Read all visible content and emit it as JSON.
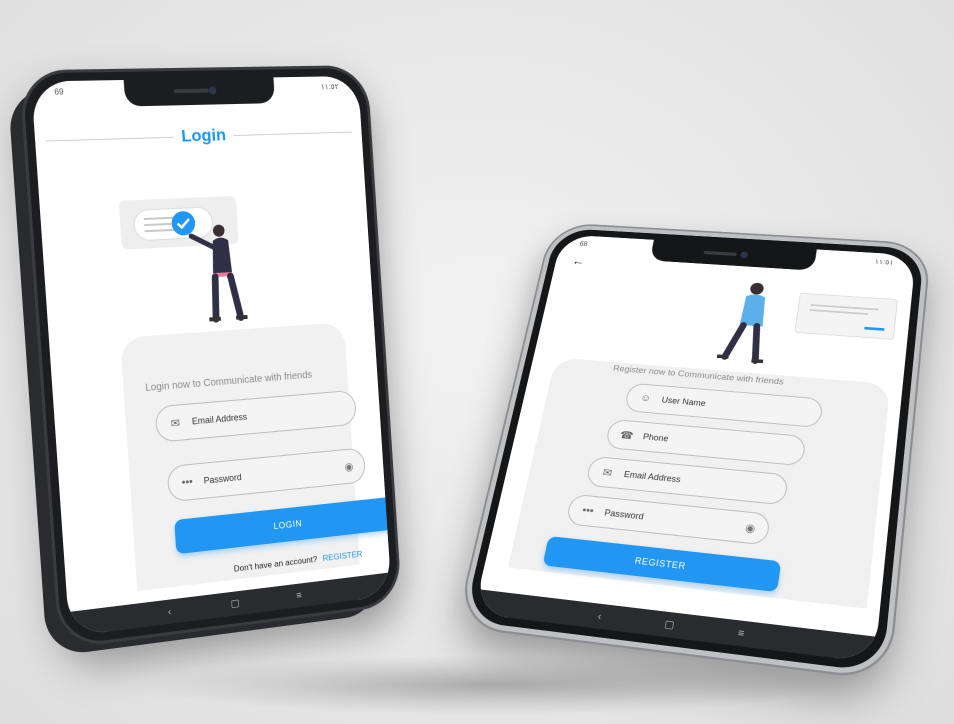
{
  "login_screen": {
    "status_left": "69",
    "status_right": "١١:٥٢",
    "title": "Login",
    "subtitle": "Login now to Communicate with friends",
    "email_placeholder": "Email Address",
    "password_placeholder": "Password",
    "login_button": "LOGIN",
    "no_account_text": "Don't have an account?",
    "register_link": "REGISTER",
    "nav": {
      "back": "‹",
      "home": "▢",
      "menu": "≡"
    }
  },
  "register_screen": {
    "status_left": "68",
    "status_right": "١١:٥١",
    "back_icon": "←",
    "subtitle": "Register now to Communicate with friends",
    "username_placeholder": "User Name",
    "phone_placeholder": "Phone",
    "email_placeholder": "Email Address",
    "password_placeholder": "Password",
    "register_button": "REGISTER",
    "nav": {
      "back": "‹",
      "home": "▢",
      "menu": "≡"
    }
  },
  "colors": {
    "accent": "#2196F3",
    "card_bg": "#f1f1f1",
    "phone_frame": "#1c1d20"
  },
  "icons": [
    "email-icon",
    "password-dots-icon",
    "eye-icon",
    "user-icon",
    "phone-icon",
    "back-arrow-icon",
    "check-badge-icon"
  ]
}
